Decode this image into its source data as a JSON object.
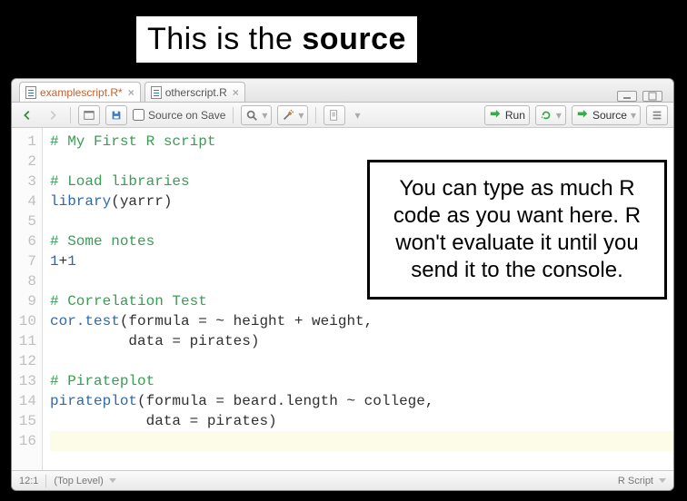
{
  "banner": {
    "prefix": "This is the ",
    "emph": "source"
  },
  "tabs": {
    "active": {
      "label": "examplescript.R*"
    },
    "other": {
      "label": "otherscript.R"
    }
  },
  "toolbar": {
    "source_on_save": "Source on Save",
    "run": "Run",
    "source_btn": "Source"
  },
  "gutter": [
    "1",
    "2",
    "3",
    "4",
    "5",
    "6",
    "7",
    "8",
    "9",
    "10",
    "11",
    "12",
    "13",
    "14",
    "15",
    "16"
  ],
  "code": {
    "lines": [
      {
        "kind": "comment",
        "text": "# My First R script"
      },
      {
        "kind": "blank",
        "text": ""
      },
      {
        "kind": "comment",
        "text": "# Load libraries"
      },
      {
        "kind": "call",
        "fn": "library",
        "args": "(yarrr)"
      },
      {
        "kind": "blank",
        "text": ""
      },
      {
        "kind": "comment",
        "text": "# Some notes"
      },
      {
        "kind": "expr",
        "tokens": [
          {
            "t": "num",
            "v": "1"
          },
          {
            "t": "op",
            "v": "+"
          },
          {
            "t": "num",
            "v": "1"
          }
        ]
      },
      {
        "kind": "blank",
        "text": ""
      },
      {
        "kind": "comment",
        "text": "# Correlation Test"
      },
      {
        "kind": "call",
        "fn": "cor.test",
        "args": "(formula = ~ height + weight,"
      },
      {
        "kind": "plain",
        "text": "         data = pirates)"
      },
      {
        "kind": "blank",
        "text": ""
      },
      {
        "kind": "comment",
        "text": "# Pirateplot"
      },
      {
        "kind": "call",
        "fn": "pirateplot",
        "args": "(formula = beard.length ~ college,"
      },
      {
        "kind": "plain",
        "text": "           data = pirates)"
      },
      {
        "kind": "cursor",
        "text": ""
      }
    ]
  },
  "status": {
    "pos": "12:1",
    "scope": "(Top Level)",
    "lang": "R Script"
  },
  "callout": "You can type as much R code as you want here. R won't evaluate it until you send it to the console."
}
